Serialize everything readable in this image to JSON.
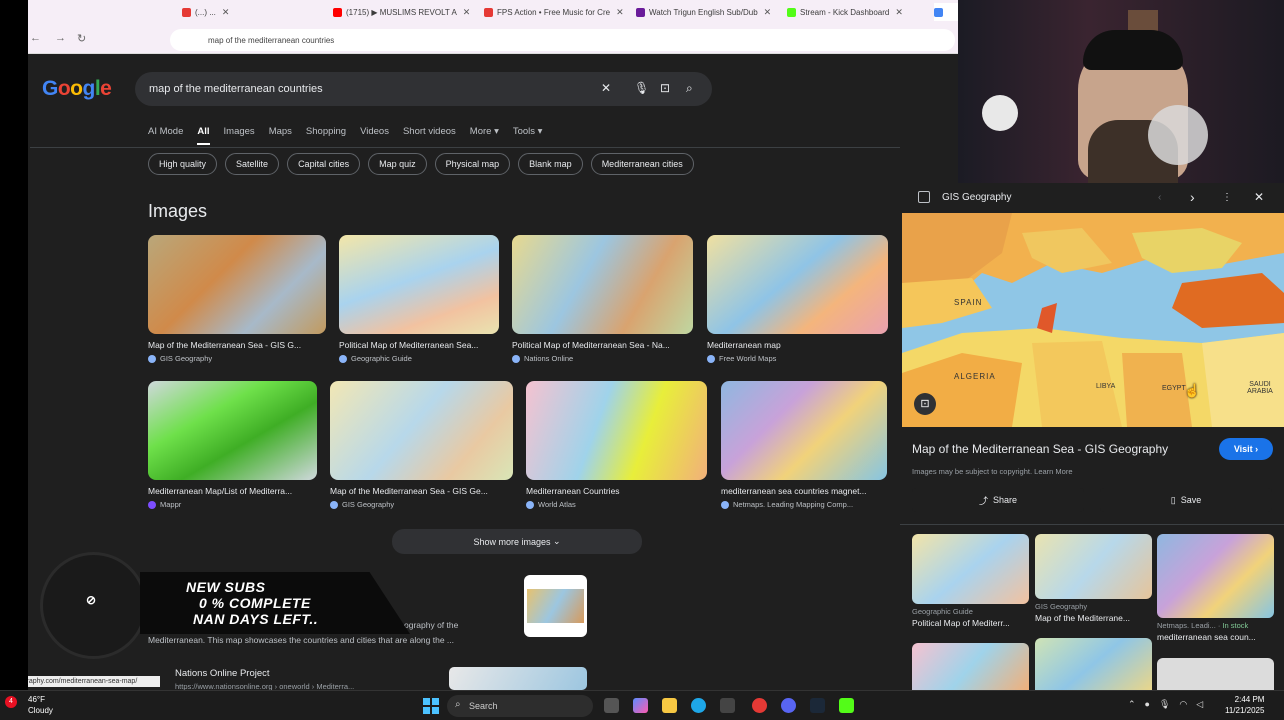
{
  "browser": {
    "tabs": [
      {
        "label": "(...) ...",
        "color": "#e53935"
      },
      {
        "label": "(1715) ▶ MUSLIMS REVOLT A",
        "color": "#ff0000"
      },
      {
        "label": "FPS Action • Free Music for Cre",
        "color": "#e53935"
      },
      {
        "label": "Watch Trigun English Sub/Dub",
        "color": "#6a1b9a"
      },
      {
        "label": "Stream - Kick Dashboard",
        "color": "#53fc18"
      }
    ],
    "url": "map of the mediterranean countries"
  },
  "google": {
    "logo": "Google",
    "query": "map of the mediterranean countries",
    "nav": [
      "AI Mode",
      "All",
      "Images",
      "Maps",
      "Shopping",
      "Videos",
      "Short videos",
      "More",
      "Tools"
    ],
    "chips": [
      "High quality",
      "Satellite",
      "Capital cities",
      "Map quiz",
      "Physical map",
      "Blank map",
      "Mediterranean cities"
    ],
    "images_heading": "Images",
    "images": [
      {
        "title": "Map of the Mediterranean Sea - GIS G...",
        "source": "GIS Geography"
      },
      {
        "title": "Political Map of Mediterranean Sea...",
        "source": "Geographic Guide"
      },
      {
        "title": "Political Map of Mediterranean Sea - Na...",
        "source": "Nations Online"
      },
      {
        "title": "Mediterranean map",
        "source": "Free World Maps"
      },
      {
        "title": "Mediterranean Map/List of Mediterra...",
        "source": "Mappr"
      },
      {
        "title": "Map of the Mediterranean Sea - GIS Ge...",
        "source": "GIS Geography"
      },
      {
        "title": "Mediterranean Countries",
        "source": "World Atlas"
      },
      {
        "title": "mediterranean sea countries magnet...",
        "source": "Netmaps. Leading Mapping Comp..."
      }
    ],
    "show_more": "Show more images",
    "snippet1": "ography of the",
    "snippet2": "Mediterranean. This map showcases the countries and cities that are along the ...",
    "result2_title": "Nations Online Project",
    "result2_url": "https://www.nationsonline.org › oneworld › Mediterra...",
    "status_url": "gisgeography.com/mediterranean-sea-map/"
  },
  "overlay": {
    "line1": "NEW SUBS",
    "line2": "0 % COMPLETE",
    "line3": "NAN DAYS LEFT.."
  },
  "panel": {
    "source": "GIS Geography",
    "title": "Map of the Mediterranean Sea - GIS Geography",
    "visit": "Visit",
    "copyright": "Images may be subject to copyright. Learn More",
    "share": "Share",
    "save": "Save",
    "map_labels": [
      "SPAIN",
      "ALGERIA",
      "LIBYA",
      "EGYPT",
      "SAUDI ARABIA"
    ],
    "related": [
      {
        "source": "Geographic Guide",
        "title": "Political Map of Mediterr..."
      },
      {
        "source": "GIS Geography",
        "title": "Map of the Mediterrane..."
      },
      {
        "source": "Netmaps. Leadi...",
        "stock": "In stock",
        "title": "mediterranean sea coun..."
      }
    ]
  },
  "taskbar": {
    "search": "Search",
    "temp": "46°F",
    "weather": "Cloudy",
    "badge": "4",
    "time": "2:44 PM",
    "date": "11/21/2025"
  }
}
